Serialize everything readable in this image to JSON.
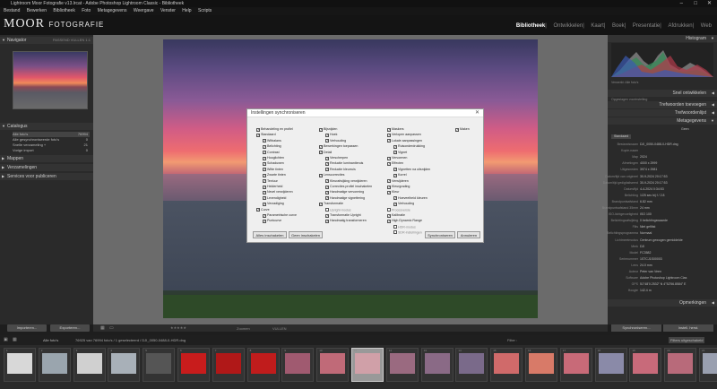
{
  "window": {
    "title": "Lightroom Moor Fotografie v13.lrcat - Adobe Photoshop Lightroom Classic - Bibliotheek",
    "minimize": "–",
    "maximize": "□",
    "close": "✕"
  },
  "menu": [
    "Bestand",
    "Bewerken",
    "Bibliotheek",
    "Foto",
    "Metagegevens",
    "Weergave",
    "Venster",
    "Help",
    "Scripts"
  ],
  "logo": {
    "main": "MOOR",
    "sub": "FOTOGRAFIE"
  },
  "modules": {
    "items": [
      "Bibliotheek",
      "Ontwikkelen",
      "Kaart",
      "Boek",
      "Presentatie",
      "Afdrukken",
      "Web"
    ],
    "active": "Bibliotheek"
  },
  "left_panel": {
    "navigator": {
      "title": "Navigator",
      "zoom": "PASSEND  VULLEN  1:1"
    },
    "catalog": {
      "title": "Catalogus",
      "rows": [
        {
          "label": "Alle foto's",
          "count": "76994"
        },
        {
          "label": "Alle gesynchroniseerde foto's",
          "count": "0"
        },
        {
          "label": "Snelle verzameling +",
          "count": "21"
        },
        {
          "label": "Vorige import",
          "count": "0"
        }
      ]
    },
    "sections": [
      "Mappen",
      "Verzamelingen",
      "Services voor publiceren"
    ],
    "buttons": {
      "import": "Importeren...",
      "export": "Exporteren..."
    }
  },
  "dialog": {
    "title": "Instellingen synchroniseren",
    "close": "✕",
    "col1": [
      {
        "label": "Behandeling en profiel",
        "checked": true,
        "indent": 0
      },
      {
        "label": "Standaard",
        "checked": true,
        "indent": 0
      },
      {
        "label": "Witbalans",
        "checked": true,
        "indent": 1
      },
      {
        "label": "Belichting",
        "checked": true,
        "indent": 1
      },
      {
        "label": "Contrast",
        "checked": true,
        "indent": 1
      },
      {
        "label": "Hooglichten",
        "checked": true,
        "indent": 1
      },
      {
        "label": "Schaduwen",
        "checked": true,
        "indent": 1
      },
      {
        "label": "Witte tinten",
        "checked": true,
        "indent": 1
      },
      {
        "label": "Zwarte tinten",
        "checked": true,
        "indent": 1
      },
      {
        "label": "Textuur",
        "checked": true,
        "indent": 1
      },
      {
        "label": "Helderheid",
        "checked": true,
        "indent": 1
      },
      {
        "label": "Nevel verwijderen",
        "checked": true,
        "indent": 1
      },
      {
        "label": "Levendigheid",
        "checked": true,
        "indent": 1
      },
      {
        "label": "Verzadiging",
        "checked": true,
        "indent": 1
      },
      {
        "label": "Curve",
        "checked": true,
        "indent": 0
      },
      {
        "label": "Parametrische curve",
        "checked": true,
        "indent": 1
      },
      {
        "label": "Puntcurve",
        "checked": true,
        "indent": 1
      }
    ],
    "col2": [
      {
        "label": "Bijsnijden",
        "checked": true,
        "indent": 0
      },
      {
        "label": "Hoek",
        "checked": true,
        "indent": 1
      },
      {
        "label": "Verhouding",
        "checked": true,
        "indent": 1
      },
      {
        "label": "Bewerkingen toepassen",
        "checked": true,
        "indent": 0
      },
      {
        "label": "Detail",
        "checked": true,
        "indent": 0
      },
      {
        "label": "Verscherpen",
        "checked": true,
        "indent": 1
      },
      {
        "label": "Reductie luminantieruis",
        "checked": true,
        "indent": 1
      },
      {
        "label": "Reductie kleurruis",
        "checked": true,
        "indent": 1
      },
      {
        "label": "Lenscorrecties",
        "checked": true,
        "indent": 0
      },
      {
        "label": "Kleurafwijking verwijderen",
        "checked": true,
        "indent": 1
      },
      {
        "label": "Correcties profiel inschakelen",
        "checked": true,
        "indent": 1
      },
      {
        "label": "Handmatige vervorming",
        "checked": true,
        "indent": 1
      },
      {
        "label": "Handmatige vignettering",
        "checked": true,
        "indent": 1
      },
      {
        "label": "Transformatie",
        "checked": true,
        "indent": 0
      },
      {
        "label": "Upright-modus",
        "checked": false,
        "indent": 1,
        "disabled": true
      },
      {
        "label": "Transformatie Upright",
        "checked": true,
        "indent": 1
      },
      {
        "label": "Handmatig transformeren",
        "checked": true,
        "indent": 1
      }
    ],
    "col3": [
      {
        "label": "Maskers",
        "checked": true,
        "indent": 0
      },
      {
        "label": "Verlopen aanpassen",
        "checked": true,
        "indent": 0
      },
      {
        "label": "Lokale aanpassingen",
        "checked": true,
        "indent": 0
      },
      {
        "label": "Ruisonderdrukking",
        "checked": true,
        "indent": 1
      },
      {
        "label": "Vignet",
        "checked": true,
        "indent": 1
      },
      {
        "label": "Vervormen",
        "checked": true,
        "indent": 0
      },
      {
        "label": "Effecten",
        "checked": true,
        "indent": 0
      },
      {
        "label": "Vignetten na uitsnijden",
        "checked": true,
        "indent": 1
      },
      {
        "label": "Korrel",
        "checked": true,
        "indent": 1
      },
      {
        "label": "Verwijderen",
        "checked": true,
        "indent": 0
      },
      {
        "label": "Kleurgrading",
        "checked": true,
        "indent": 0
      },
      {
        "label": "Kleur",
        "checked": true,
        "indent": 0
      },
      {
        "label": "Hoeveelheid kleuren",
        "checked": true,
        "indent": 1
      },
      {
        "label": "Verhouding",
        "checked": true,
        "indent": 1
      },
      {
        "label": "Procesversie",
        "checked": false,
        "indent": 0,
        "disabled": true
      },
      {
        "label": "Kalibratie",
        "checked": true,
        "indent": 0
      },
      {
        "label": "High Dynamic Range",
        "checked": true,
        "indent": 0
      },
      {
        "label": "HDR-modus",
        "checked": false,
        "indent": 1,
        "disabled": true
      },
      {
        "label": "SDR-instellingen",
        "checked": false,
        "indent": 1,
        "disabled": true
      }
    ],
    "col4": [
      {
        "label": "Maken",
        "checked": true,
        "indent": 0
      }
    ],
    "buttons": {
      "check_all": "Alles inschakelen",
      "check_none": "Geen inschakelen",
      "sync": "Synchroniseren",
      "cancel": "Annuleren"
    }
  },
  "right_panel": {
    "histogram": {
      "title": "Histogram",
      "info": "Verwerkt: Alle foto's"
    },
    "quick": {
      "title": "Snel ontwikkelen",
      "saved": "Opgeslagen voorinstelling"
    },
    "keywords": {
      "title": "Trefwoorden toevoegen",
      "list": "Trefwoordenlijst"
    },
    "metadata": {
      "title": "Metagegevens",
      "preset": "Geen",
      "mode": "Standaard",
      "rows": [
        {
          "k": "Bestandsnaam",
          "v": "DJI_0050-0488-0-HDR.dng"
        },
        {
          "k": "Kopie-naam",
          "v": ""
        },
        {
          "k": "Map",
          "v": "2024"
        },
        {
          "k": "Afmetingen",
          "v": "4000 x 2999"
        },
        {
          "k": "Uitgesneden",
          "v": "3974 x 2981"
        },
        {
          "k": "Datum/tijd van origineel",
          "v": "30-9-2024 20:17:53"
        },
        {
          "k": "Datum/tijd gedigitaliseerd",
          "v": "30-9-2024 20:17:53"
        },
        {
          "k": "Datum/tijd",
          "v": "4-4-2024 0:34:53"
        },
        {
          "k": "Belichting",
          "v": "1/25 sec bij f / 2.8"
        },
        {
          "k": "Brandpuntsafstand",
          "v": "6.82 mm"
        },
        {
          "k": "Brandpuntsafstand 35mm",
          "v": "24 mm"
        },
        {
          "k": "ISO-lichtgevoeligheid",
          "v": "ISO 100"
        },
        {
          "k": "Belichtingsafwijking",
          "v": "0 belichtingswaarde"
        },
        {
          "k": "Flits",
          "v": "Niet geflitst"
        },
        {
          "k": "Belichtingsprogramma",
          "v": "Normaal"
        },
        {
          "k": "Lichtmeetmodus",
          "v": "Centrum gewogen gemiddelde"
        },
        {
          "k": "Merk",
          "v": "DJI"
        },
        {
          "k": "Model",
          "v": "FC3582"
        },
        {
          "k": "Serienummer",
          "v": "1STCJ1S00003"
        },
        {
          "k": "Lens",
          "v": "24.0 mm"
        },
        {
          "k": "Auteur",
          "v": "Peter van Veen"
        },
        {
          "k": "Software",
          "v": "Adobe Photoshop Lightroom Clas"
        },
        {
          "k": "GPS",
          "v": "51°48'0.2532\" N 4°52'56.8584\" E"
        },
        {
          "k": "Hoogte",
          "v": "142.4 m"
        }
      ]
    },
    "comments": {
      "title": "Opmerkingen"
    },
    "buttons": {
      "sync": "Synchroniseren...",
      "reset": "Instell. herst."
    }
  },
  "toolbar": {
    "stars": "★★★★★",
    "zoom_label": "Zoomen",
    "zoom_value": "VULLEN"
  },
  "filmstrip_bar": {
    "source": "Alle foto's",
    "info": "76925 van 76994 foto's / 1 geselecteerd / DJI_0050-0488-0-HDR.dng",
    "filter_label": "Filter :",
    "filter_value": "Filters uitgeschakeld"
  },
  "thumbs": [
    {
      "num": "1",
      "c": "#d8d8d8"
    },
    {
      "num": "2",
      "c": "#9aa5ae"
    },
    {
      "num": "3",
      "c": "#d0d0d0"
    },
    {
      "num": "4",
      "c": "#a8b0b8"
    },
    {
      "num": "5",
      "c": "#555"
    },
    {
      "num": "6",
      "c": "#c81c1c"
    },
    {
      "num": "7",
      "c": "#b01818"
    },
    {
      "num": "8",
      "c": "#c01c1c"
    },
    {
      "num": "9",
      "c": "#a05a70"
    },
    {
      "num": "10",
      "c": "#c06a78"
    },
    {
      "num": "11",
      "c": "#d0a0a8",
      "sel": true
    },
    {
      "num": "12",
      "c": "#9a6a80"
    },
    {
      "num": "13",
      "c": "#8a6a86"
    },
    {
      "num": "14",
      "c": "#7a6a8a"
    },
    {
      "num": "15",
      "c": "#d06a6a"
    },
    {
      "num": "16",
      "c": "#d87a68"
    },
    {
      "num": "17",
      "c": "#c86a78"
    },
    {
      "num": "18",
      "c": "#8a8aa8"
    },
    {
      "num": "19",
      "c": "#c86a7a"
    },
    {
      "num": "20",
      "c": "#b86a7a"
    },
    {
      "num": "21",
      "c": "#9aa0b0"
    }
  ]
}
